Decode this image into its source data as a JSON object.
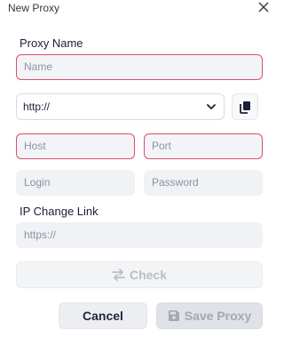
{
  "dialog": {
    "title": "New Proxy",
    "close_icon": "close-icon"
  },
  "form": {
    "proxy_name_label": "Proxy Name",
    "name_placeholder": "Name",
    "protocol_value": "http://",
    "host_placeholder": "Host",
    "port_placeholder": "Port",
    "login_placeholder": "Login",
    "password_placeholder": "Password",
    "ip_change_label": "IP Change Link",
    "ip_change_placeholder": "https://"
  },
  "buttons": {
    "check_label": "Check",
    "cancel_label": "Cancel",
    "save_label": "Save Proxy"
  },
  "colors": {
    "invalid_border": "#d8506b",
    "field_bg": "#f0f2f5",
    "text_primary": "#1a1f36",
    "disabled_text": "#a3a9b4"
  }
}
